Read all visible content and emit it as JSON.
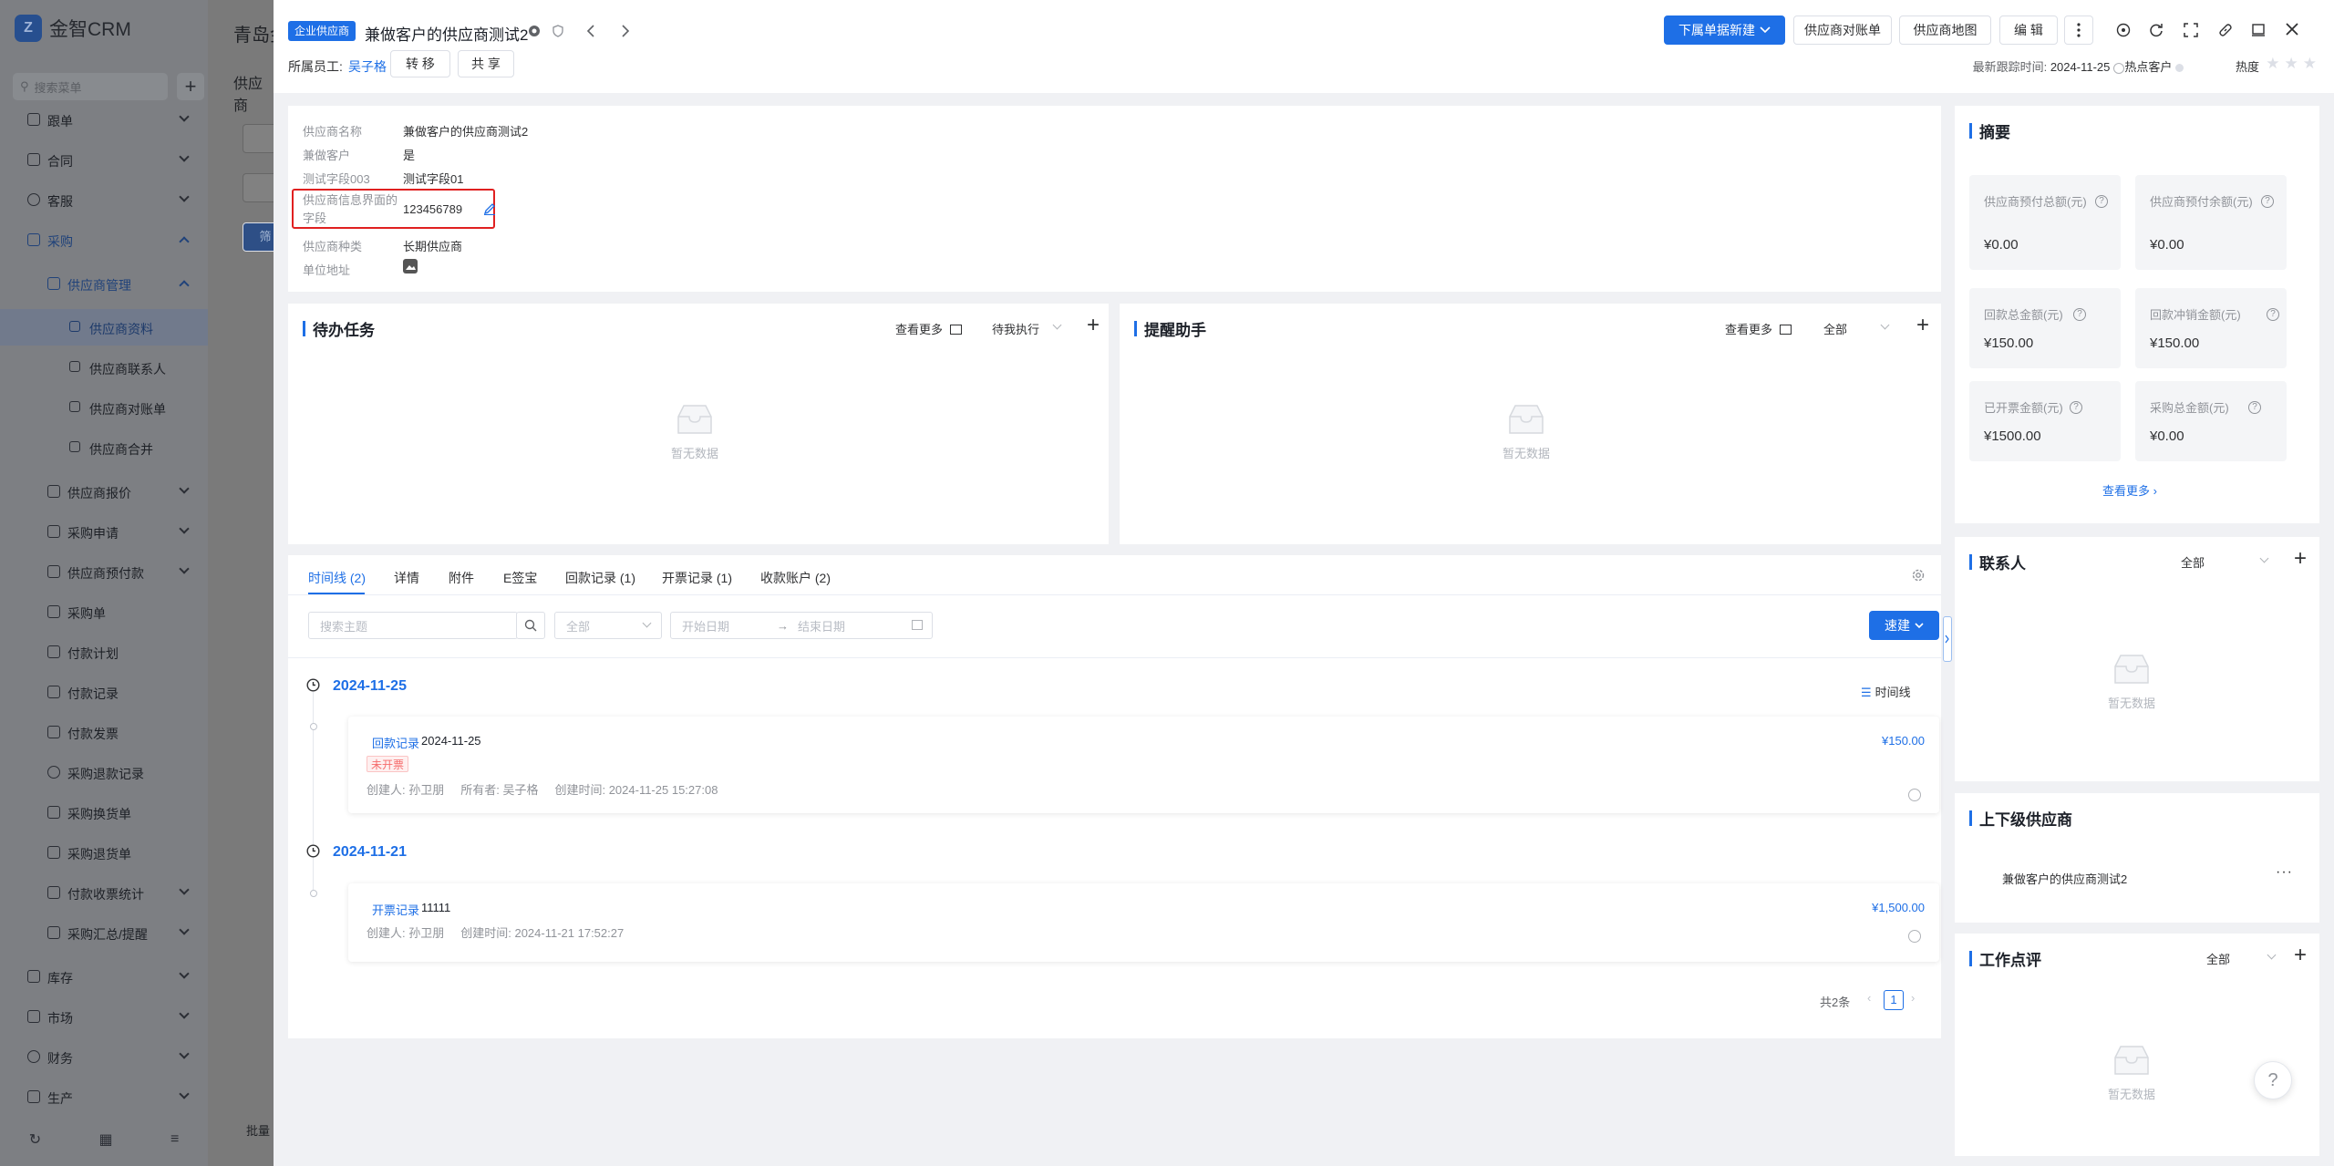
{
  "sidebar": {
    "app_name": "金智CRM",
    "search_placeholder": "搜索菜单",
    "items": [
      {
        "label": "跟单"
      },
      {
        "label": "合同"
      },
      {
        "label": "客服"
      },
      {
        "label": "采购"
      },
      {
        "label": "供应商管理"
      },
      {
        "label": "供应商资料"
      },
      {
        "label": "供应商联系人"
      },
      {
        "label": "供应商对账单"
      },
      {
        "label": "供应商合并"
      },
      {
        "label": "供应商报价"
      },
      {
        "label": "采购申请"
      },
      {
        "label": "供应商预付款"
      },
      {
        "label": "采购单"
      },
      {
        "label": "付款计划"
      },
      {
        "label": "付款记录"
      },
      {
        "label": "付款发票"
      },
      {
        "label": "采购退款记录"
      },
      {
        "label": "采购换货单"
      },
      {
        "label": "采购退货单"
      },
      {
        "label": "付款收票统计"
      },
      {
        "label": "采购汇总/提醒"
      },
      {
        "label": "库存"
      },
      {
        "label": "市场"
      },
      {
        "label": "财务"
      },
      {
        "label": "生产"
      }
    ]
  },
  "background_page": {
    "title": "青岛金",
    "subtitle": "供应商",
    "filter_button": "筛",
    "batch_label": "批量"
  },
  "header": {
    "tag": "企业供应商",
    "title": "兼做客户的供应商测试2",
    "primary_action": "下属单据新建",
    "statement_button": "供应商对账单",
    "map_button": "供应商地图",
    "edit_button": "编 辑",
    "owner_label": "所属员工:",
    "owner_name": "吴子格",
    "transfer_button": "转 移",
    "share_button": "共 享",
    "last_follow_label": "最新跟踪时间:",
    "last_follow_date": "2024-11-25",
    "hot_customer": "热点客户",
    "heat_label": "热度"
  },
  "info": {
    "fields": [
      {
        "label": "供应商名称",
        "value": "兼做客户的供应商测试2"
      },
      {
        "label": "兼做客户",
        "value": "是"
      },
      {
        "label": "测试字段003",
        "value": "测试字段01"
      },
      {
        "label": "供应商信息界面的字段",
        "value": "123456789"
      },
      {
        "label": "供应商种类",
        "value": "长期供应商"
      },
      {
        "label": "单位地址",
        "value": ""
      }
    ],
    "highlight_color": "#e02020"
  },
  "todo": {
    "title": "待办任务",
    "more": "查看更多",
    "filter": "待我执行",
    "empty": "暂无数据"
  },
  "reminder": {
    "title": "提醒助手",
    "more": "查看更多",
    "filter": "全部",
    "empty": "暂无数据"
  },
  "tabs": [
    {
      "label": "时间线 (2)"
    },
    {
      "label": "详情"
    },
    {
      "label": "附件"
    },
    {
      "label": "E签宝"
    },
    {
      "label": "回款记录 (1)"
    },
    {
      "label": "开票记录 (1)"
    },
    {
      "label": "收款账户 (2)"
    }
  ],
  "timeline_filters": {
    "search_placeholder": "搜索主题",
    "type_value": "全部",
    "start_placeholder": "开始日期",
    "end_placeholder": "结束日期",
    "quick_button": "速建",
    "view_label": "时间线"
  },
  "timeline": [
    {
      "date": "2024-11-25",
      "kind": "回款记录",
      "subject": "2024-11-25",
      "amount": "¥150.00",
      "status": "未开票",
      "creator": "创建人: 孙卫朋",
      "owner": "所有者: 吴子格",
      "created": "创建时间: 2024-11-25 15:27:08"
    },
    {
      "date": "2024-11-21",
      "kind": "开票记录",
      "subject": "11111",
      "amount": "¥1,500.00",
      "creator": "创建人: 孙卫朋",
      "created": "创建时间: 2024-11-21 17:52:27"
    }
  ],
  "pagination": {
    "total": "共2条",
    "current": "1"
  },
  "summary": {
    "title": "摘要",
    "cells": [
      {
        "label": "供应商预付总额(元)",
        "value": "¥0.00"
      },
      {
        "label": "供应商预付余额(元)",
        "value": "¥0.00"
      },
      {
        "label": "回款总金额(元)",
        "value": "¥150.00"
      },
      {
        "label": "回款冲销金额(元)",
        "value": "¥150.00"
      },
      {
        "label": "已开票金额(元)",
        "value": "¥1500.00"
      },
      {
        "label": "采购总金额(元)",
        "value": "¥0.00"
      }
    ],
    "more": "查看更多"
  },
  "contacts": {
    "title": "联系人",
    "filter": "全部",
    "empty": "暂无数据"
  },
  "hierarchy": {
    "title": "上下级供应商",
    "item": "兼做客户的供应商测试2"
  },
  "work_review": {
    "title": "工作点评",
    "filter": "全部",
    "empty": "暂无数据"
  },
  "colors": {
    "accent": "#1e6fe6",
    "danger": "#f56c6c"
  }
}
